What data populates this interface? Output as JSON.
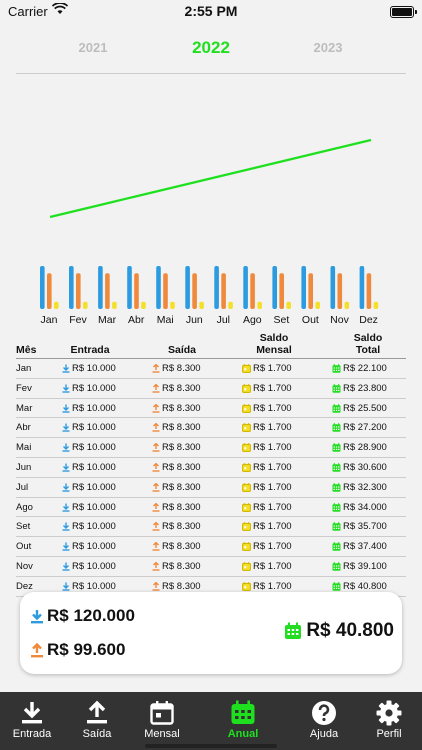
{
  "status": {
    "carrier": "Carrier",
    "time": "2:55 PM"
  },
  "years": [
    "2021",
    "2022",
    "2023"
  ],
  "selected_year": "2022",
  "colors": {
    "entrada": "#2d9be0",
    "saida": "#ef8a3c",
    "saldo_mensal": "#f4e02a",
    "saldo_total": "#22dd22",
    "trend": "#1fe01f"
  },
  "chart_data": {
    "type": "bar",
    "categories": [
      "Jan",
      "Fev",
      "Mar",
      "Abr",
      "Mai",
      "Jun",
      "Jul",
      "Ago",
      "Set",
      "Out",
      "Nov",
      "Dez"
    ],
    "series": [
      {
        "values": [
          10000,
          10000,
          10000,
          10000,
          10000,
          10000,
          10000,
          10000,
          10000,
          10000,
          10000,
          10000
        ]
      },
      {
        "values": [
          8300,
          8300,
          8300,
          8300,
          8300,
          8300,
          8300,
          8300,
          8300,
          8300,
          8300,
          8300
        ]
      },
      {
        "values": [
          1700,
          1700,
          1700,
          1700,
          1700,
          1700,
          1700,
          1700,
          1700,
          1700,
          1700,
          1700
        ]
      }
    ],
    "line": {
      "values": [
        22100,
        23800,
        25500,
        27200,
        28900,
        30600,
        32300,
        34000,
        35700,
        37400,
        39100,
        40800
      ]
    }
  },
  "table": {
    "headers": {
      "mes": "Mês",
      "entrada": "Entrada",
      "saida": "Saída",
      "saldo_mensal_1": "Saldo",
      "saldo_mensal_2": "Mensal",
      "saldo_total_1": "Saldo",
      "saldo_total_2": "Total"
    },
    "rows": [
      {
        "mes": "Jan",
        "entrada": "R$ 10.000",
        "saida": "R$ 8.300",
        "saldo": "R$ 1.700",
        "total": "R$ 22.100"
      },
      {
        "mes": "Fev",
        "entrada": "R$ 10.000",
        "saida": "R$ 8.300",
        "saldo": "R$ 1.700",
        "total": "R$ 23.800"
      },
      {
        "mes": "Mar",
        "entrada": "R$ 10.000",
        "saida": "R$ 8.300",
        "saldo": "R$ 1.700",
        "total": "R$ 25.500"
      },
      {
        "mes": "Abr",
        "entrada": "R$ 10.000",
        "saida": "R$ 8.300",
        "saldo": "R$ 1.700",
        "total": "R$ 27.200"
      },
      {
        "mes": "Mai",
        "entrada": "R$ 10.000",
        "saida": "R$ 8.300",
        "saldo": "R$ 1.700",
        "total": "R$ 28.900"
      },
      {
        "mes": "Jun",
        "entrada": "R$ 10.000",
        "saida": "R$ 8.300",
        "saldo": "R$ 1.700",
        "total": "R$ 30.600"
      },
      {
        "mes": "Jul",
        "entrada": "R$ 10.000",
        "saida": "R$ 8.300",
        "saldo": "R$ 1.700",
        "total": "R$ 32.300"
      },
      {
        "mes": "Ago",
        "entrada": "R$ 10.000",
        "saida": "R$ 8.300",
        "saldo": "R$ 1.700",
        "total": "R$ 34.000"
      },
      {
        "mes": "Set",
        "entrada": "R$ 10.000",
        "saida": "R$ 8.300",
        "saldo": "R$ 1.700",
        "total": "R$ 35.700"
      },
      {
        "mes": "Out",
        "entrada": "R$ 10.000",
        "saida": "R$ 8.300",
        "saldo": "R$ 1.700",
        "total": "R$ 37.400"
      },
      {
        "mes": "Nov",
        "entrada": "R$ 10.000",
        "saida": "R$ 8.300",
        "saldo": "R$ 1.700",
        "total": "R$ 39.100"
      },
      {
        "mes": "Dez",
        "entrada": "R$ 10.000",
        "saida": "R$ 8.300",
        "saldo": "R$ 1.700",
        "total": "R$ 40.800"
      }
    ]
  },
  "summary": {
    "entrada": "R$ 120.000",
    "saida": "R$ 99.600",
    "total": "R$ 40.800"
  },
  "tabs": [
    {
      "label": "Entrada",
      "icon": "download-icon"
    },
    {
      "label": "Saída",
      "icon": "upload-icon"
    },
    {
      "label": "Mensal",
      "icon": "calendar-icon"
    },
    {
      "label": "Anual",
      "icon": "calendar-grid-icon",
      "active": true
    },
    {
      "label": "Ajuda",
      "icon": "help-icon"
    },
    {
      "label": "Perfil",
      "icon": "gear-icon"
    }
  ]
}
